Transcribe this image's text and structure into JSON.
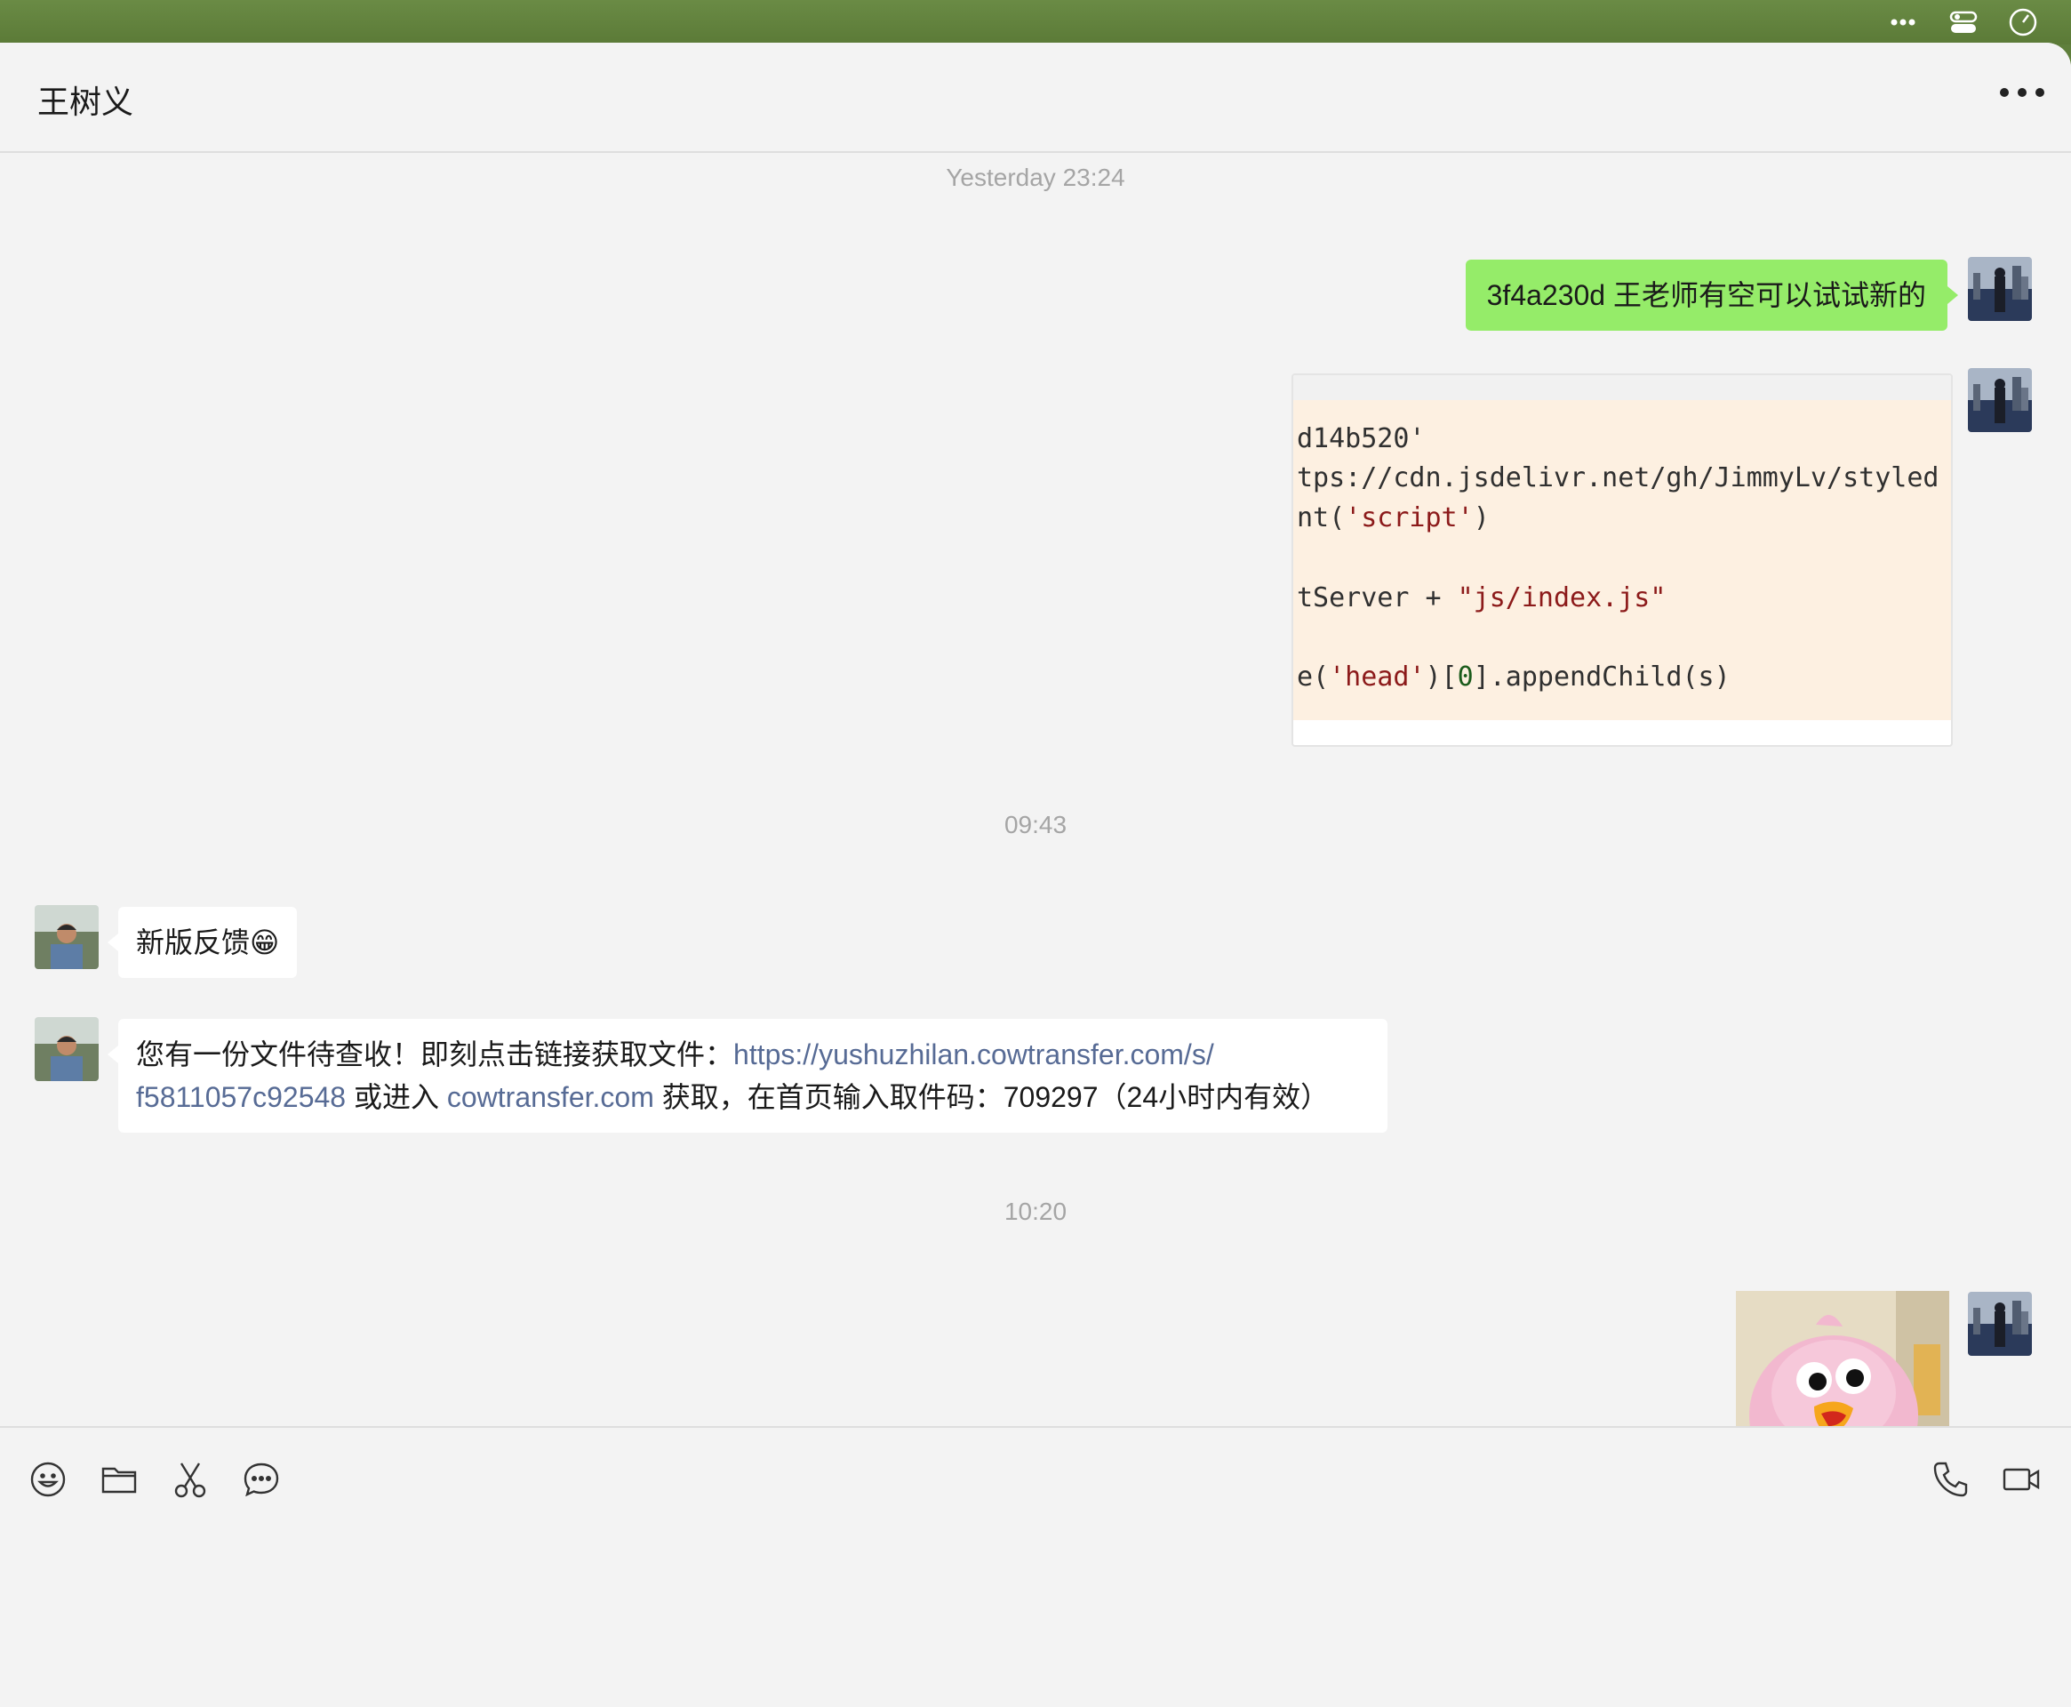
{
  "chat": {
    "title": "王树义"
  },
  "timestamps": [
    "Yesterday 23:24",
    "09:43",
    "10:20"
  ],
  "messages": {
    "m1": {
      "text": "3f4a230d 王老师有空可以试试新的"
    },
    "m2": {
      "code_lines": [
        "d14b520'",
        "tps://cdn.jsdelivr.net/gh/JimmyLv/styled",
        "nt(",
        "'script'",
        ")",
        "tServer + ",
        "\"js/index.js\"",
        "e(",
        "'head'",
        ")[",
        "0",
        "].appendChild(s)"
      ]
    },
    "m3": {
      "text": "新版反馈",
      "emoji": "😁"
    },
    "m4": {
      "text_a": "您有一份文件待查收！即刻点击链接获取文件：",
      "link_a": "https://yushuzhilan.cowtransfer.com/s/",
      "link_b": "f5811057c92548",
      "text_b": " 或进入 ",
      "link_c": "cowtransfer.com",
      "text_c": " 获取，在首页输入取件码：709297（24小时内有效）"
    }
  },
  "toolbar": {
    "left": [
      "emoji-icon",
      "folder-icon",
      "scissors-icon",
      "chat-history-icon"
    ],
    "right": [
      "phone-icon",
      "video-call-icon"
    ]
  },
  "colors": {
    "sent_bubble": "#95ec69",
    "link": "#576b95",
    "desktop": "#5f7f3c"
  }
}
